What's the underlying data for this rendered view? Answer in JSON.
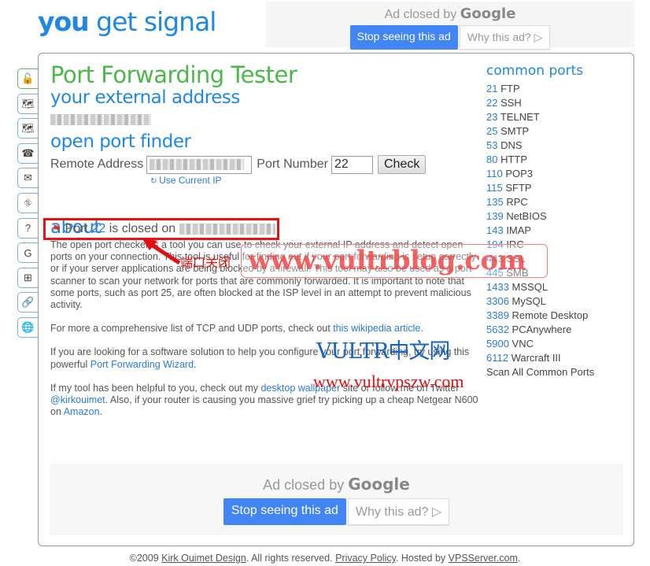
{
  "logo": {
    "part1": "you",
    "part2": " get signal"
  },
  "ad_top": {
    "closed_by": "Ad closed by ",
    "brand": "Google",
    "stop_label": "Stop seeing this ad",
    "why_label": "Why this ad? ▷"
  },
  "tabs": [
    {
      "name": "port-forwarding-tab",
      "icon": "🔓",
      "active": true
    },
    {
      "name": "visual-traceroute-tab",
      "icon": "🗺",
      "active": false
    },
    {
      "name": "network-location-tab",
      "icon": "🗺",
      "active": false
    },
    {
      "name": "phone-owner-tab",
      "icon": "☎",
      "active": false
    },
    {
      "name": "email-tab",
      "icon": "✉",
      "active": false
    },
    {
      "name": "network-tools-tab",
      "icon": "⛗",
      "active": false
    },
    {
      "name": "help-tab",
      "icon": "?",
      "active": false
    },
    {
      "name": "google-tab",
      "icon": "G",
      "active": false
    },
    {
      "name": "windows-tab",
      "icon": "⊞",
      "active": false
    },
    {
      "name": "link-tab",
      "icon": "🔗",
      "active": false
    },
    {
      "name": "globe-tab",
      "icon": "🌐",
      "active": false
    }
  ],
  "main": {
    "title": "Port Forwarding Tester",
    "external_heading": "your external address",
    "finder_heading": "open port finder",
    "remote_label": "Remote Address",
    "port_label": "Port Number",
    "port_value": "22",
    "check_label": "Check",
    "use_current_ip": "Use Current IP",
    "result_prefix": "Port ",
    "result_port": "22",
    "result_mid": " is closed on ",
    "about_heading": "about",
    "about_p1": "The open port checker is a tool you can use to check your external IP address and detect open ports on your connection. This tool is useful for finding out if your port forwarding is setup correctly or if your server applications are being blocked by a firewall. This tool may also be used as a port scanner to scan your network for ports that are commonly forwarded. It is important to note that some ports, such as port 25, are often blocked at the ISP level in an attempt to prevent malicious activity.",
    "about_p2_pre": "For more a comprehensive list of TCP and UDP ports, check out ",
    "about_p2_link": "this wikipedia article",
    "about_p2_post": ".",
    "about_p3_pre": "If you are looking for a software solution to help you configure your port forwarding, try using this powerful ",
    "about_p3_link": "Port Forwarding Wizard",
    "about_p3_post": ".",
    "about_p4_a": "If my tool has been helpful to you, check out my ",
    "about_p4_link1": "desktop wallpaper",
    "about_p4_b": " site or follow me on Twitter ",
    "about_p4_link2": "@kirkouimet",
    "about_p4_c": ". Also, if your router is causing you massive grief try picking up a cheap Netgear N600 on ",
    "about_p4_link3": "Amazon",
    "about_p4_d": "."
  },
  "sidebar": {
    "heading": "common ports",
    "ports": [
      {
        "num": "21",
        "name": " FTP"
      },
      {
        "num": "22",
        "name": " SSH"
      },
      {
        "num": "23",
        "name": " TELNET"
      },
      {
        "num": "25",
        "name": " SMTP"
      },
      {
        "num": "53",
        "name": " DNS"
      },
      {
        "num": "80",
        "name": " HTTP"
      },
      {
        "num": "110",
        "name": " POP3"
      },
      {
        "num": "115",
        "name": " SFTP"
      },
      {
        "num": "135",
        "name": " RPC"
      },
      {
        "num": "139",
        "name": " NetBIOS"
      },
      {
        "num": "143",
        "name": " IMAP"
      },
      {
        "num": "194",
        "name": " IRC"
      },
      {
        "num": "443",
        "name": " SSL"
      },
      {
        "num": "445",
        "name": " SMB"
      },
      {
        "num": "1433",
        "name": " MSSQL"
      },
      {
        "num": "3306",
        "name": " MySQL"
      },
      {
        "num": "3389",
        "name": " Remote Desktop"
      },
      {
        "num": "5632",
        "name": " PCAnywhere"
      },
      {
        "num": "5900",
        "name": " VNC"
      },
      {
        "num": "6112",
        "name": " Warcraft III"
      }
    ],
    "scan_all": "Scan All Common Ports"
  },
  "ad_bottom": {
    "closed_by": "Ad closed by ",
    "brand": "Google",
    "stop_label": "Stop seeing this ad",
    "why_label": "Why this ad? ▷"
  },
  "footer": {
    "copyright": "©2009 ",
    "company": "Kirk Ouimet Design",
    "rights": ". All rights reserved. ",
    "privacy": "Privacy Policy",
    "hosted": ". Hosted by ",
    "host": "VPSServer.com",
    "end": "."
  },
  "watermarks": {
    "annotation": "端口关闭",
    "blog": "www.vultrblog.com",
    "vultr": "VULTR中文网",
    "vps": "www.vultrvpszw.com"
  },
  "colors": {
    "accent_blue": "#1e88e5",
    "title_green": "#4cb84c",
    "highlight_red": "#ee1111",
    "google_blue": "#4285f4"
  }
}
